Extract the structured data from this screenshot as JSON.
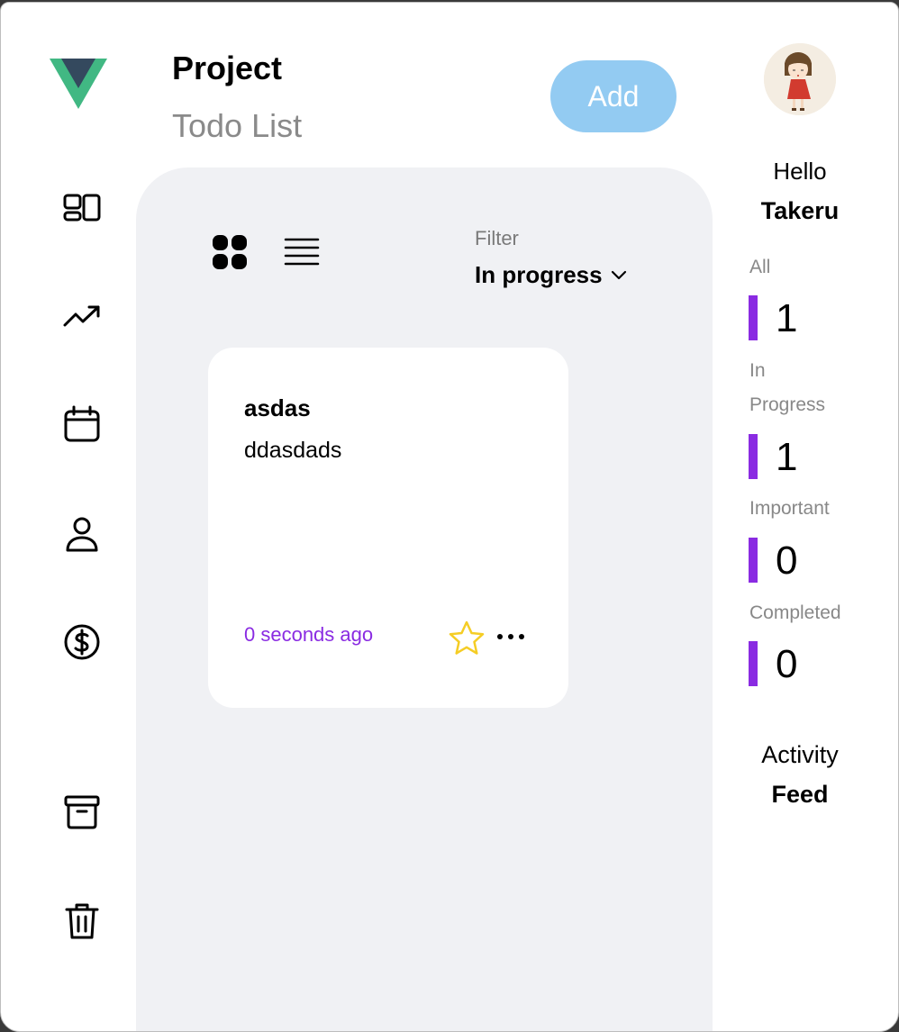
{
  "header": {
    "title": "Project",
    "subtitle": "Todo List",
    "add_label": "Add"
  },
  "sidebar": {
    "items": [
      {
        "icon": "dashboard-icon"
      },
      {
        "icon": "trending-up-icon"
      },
      {
        "icon": "calendar-icon"
      },
      {
        "icon": "user-icon"
      },
      {
        "icon": "dollar-icon"
      },
      {
        "icon": "archive-icon"
      },
      {
        "icon": "trash-icon"
      }
    ]
  },
  "filter": {
    "label": "Filter",
    "selected": "In progress"
  },
  "todos": [
    {
      "title": "asdas",
      "description": "ddasdads",
      "time": "0 seconds ago",
      "important": false
    }
  ],
  "profile": {
    "greeting": "Hello",
    "name": "Takeru"
  },
  "stats": {
    "all": {
      "label": "All",
      "value": "1"
    },
    "in_progress": {
      "label_line1": "In",
      "label_line2": "Progress",
      "value": "1"
    },
    "important": {
      "label": "Important",
      "value": "0"
    },
    "completed": {
      "label": "Completed",
      "value": "0"
    }
  },
  "activity": {
    "line1": "Activity",
    "line2": "Feed"
  },
  "colors": {
    "accent": "#8a2be2",
    "add_button": "#93cbf2",
    "panel_bg": "#f0f1f4",
    "star": "#f5cd25"
  }
}
